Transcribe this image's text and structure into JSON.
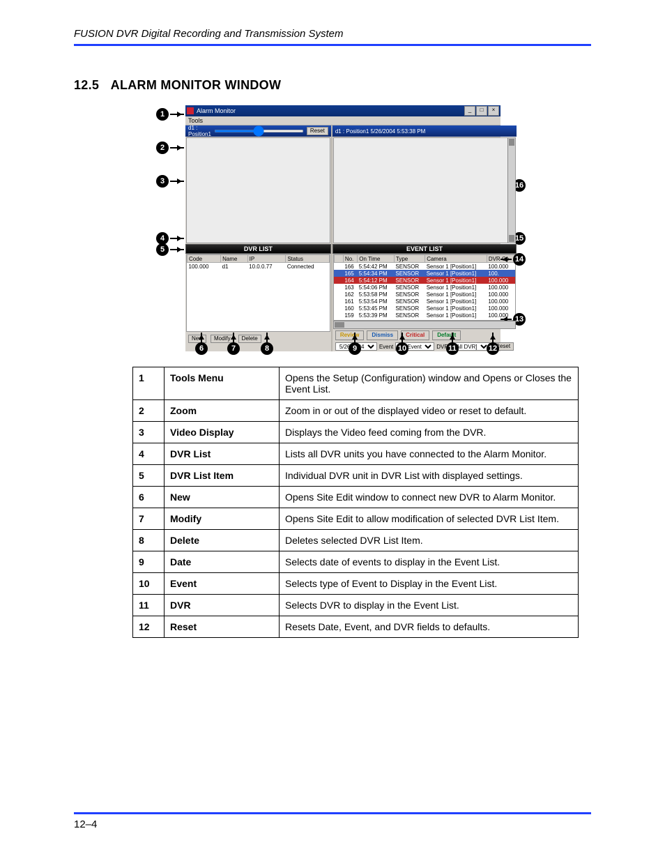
{
  "header": "FUSION DVR Digital Recording and Transmission System",
  "section_num": "12.5",
  "section_title": "ALARM MONITOR WINDOW",
  "page_num": "12–4",
  "win": {
    "title": "Alarm Monitor",
    "menu_tools": "Tools",
    "zoom_label": "d1 : Position1",
    "reset": "Reset",
    "video_info": "d1 : Position1   5/26/2004 5:53:38 PM",
    "dvr_list_hdr": "DVR LIST",
    "event_list_hdr": "EVENT LIST",
    "dvr_cols": [
      "Code",
      "Name",
      "IP",
      "Status"
    ],
    "dvr_row": [
      "100.000",
      "d1",
      "10.0.0.77",
      "Connected"
    ],
    "dvr_btns": {
      "new": "New",
      "modify": "Modify",
      "delete": "Delete"
    },
    "ev_cols": [
      "No.",
      "On Time",
      "Type",
      "Camera",
      "DVR Co"
    ],
    "ev_rows": [
      [
        "166",
        "5:54:42 PM",
        "SENSOR",
        "Sensor 1 [Position1]",
        "100.000"
      ],
      [
        "165",
        "5:54:34 PM",
        "SENSOR",
        "Sensor 1 [Position1]",
        "100."
      ],
      [
        "164",
        "5:54:12 PM",
        "SENSOR",
        "Sensor 1 [Position1]",
        "100.000"
      ],
      [
        "163",
        "5:54:06 PM",
        "SENSOR",
        "Sensor 1 [Position1]",
        "100.000"
      ],
      [
        "162",
        "5:53:58 PM",
        "SENSOR",
        "Sensor 1 [Position1]",
        "100.000"
      ],
      [
        "161",
        "5:53:54 PM",
        "SENSOR",
        "Sensor 1 [Position1]",
        "100.000"
      ],
      [
        "160",
        "5:53:45 PM",
        "SENSOR",
        "Sensor 1 [Position1]",
        "100.000"
      ],
      [
        "159",
        "5:53:39 PM",
        "SENSOR",
        "Sensor 1 [Position1]",
        "100.000"
      ]
    ],
    "tags": {
      "review": "Review",
      "dismiss": "Dismiss",
      "critical": "Critical",
      "default": "Default"
    },
    "filter": {
      "date": "5/26/2004",
      "event_lbl": "Event",
      "event_val": "All Event",
      "dvr_lbl": "DVR",
      "dvr_val": "[All DVR]",
      "reset": "Reset"
    }
  },
  "callouts": [
    "1",
    "2",
    "3",
    "4",
    "5",
    "6",
    "7",
    "8",
    "9",
    "10",
    "11",
    "12",
    "13",
    "14",
    "15",
    "16"
  ],
  "table": [
    {
      "n": "1",
      "t": "Tools Menu",
      "d": "Opens the Setup (Configuration) window and Opens or Closes the Event List."
    },
    {
      "n": "2",
      "t": "Zoom",
      "d": "Zoom in or out of the displayed video or reset to default."
    },
    {
      "n": "3",
      "t": "Video Display",
      "d": "Displays the Video feed coming from the DVR."
    },
    {
      "n": "4",
      "t": "DVR List",
      "d": "Lists all DVR units you have connected to the Alarm Monitor."
    },
    {
      "n": "5",
      "t": "DVR List Item",
      "d": "Individual DVR unit in DVR List with displayed settings."
    },
    {
      "n": "6",
      "t": "New",
      "d": "Opens Site Edit window to connect new DVR to Alarm Monitor."
    },
    {
      "n": "7",
      "t": "Modify",
      "d": "Opens Site Edit to allow modification of selected DVR List Item."
    },
    {
      "n": "8",
      "t": "Delete",
      "d": "Deletes selected DVR List Item."
    },
    {
      "n": "9",
      "t": "Date",
      "d": "Selects date of events to display in the Event List."
    },
    {
      "n": "10",
      "t": "Event",
      "d": "Selects type of Event to Display in the Event List."
    },
    {
      "n": "11",
      "t": "DVR",
      "d": "Selects DVR to display in the Event List."
    },
    {
      "n": "12",
      "t": "Reset",
      "d": "Resets Date, Event, and DVR fields to defaults."
    }
  ]
}
